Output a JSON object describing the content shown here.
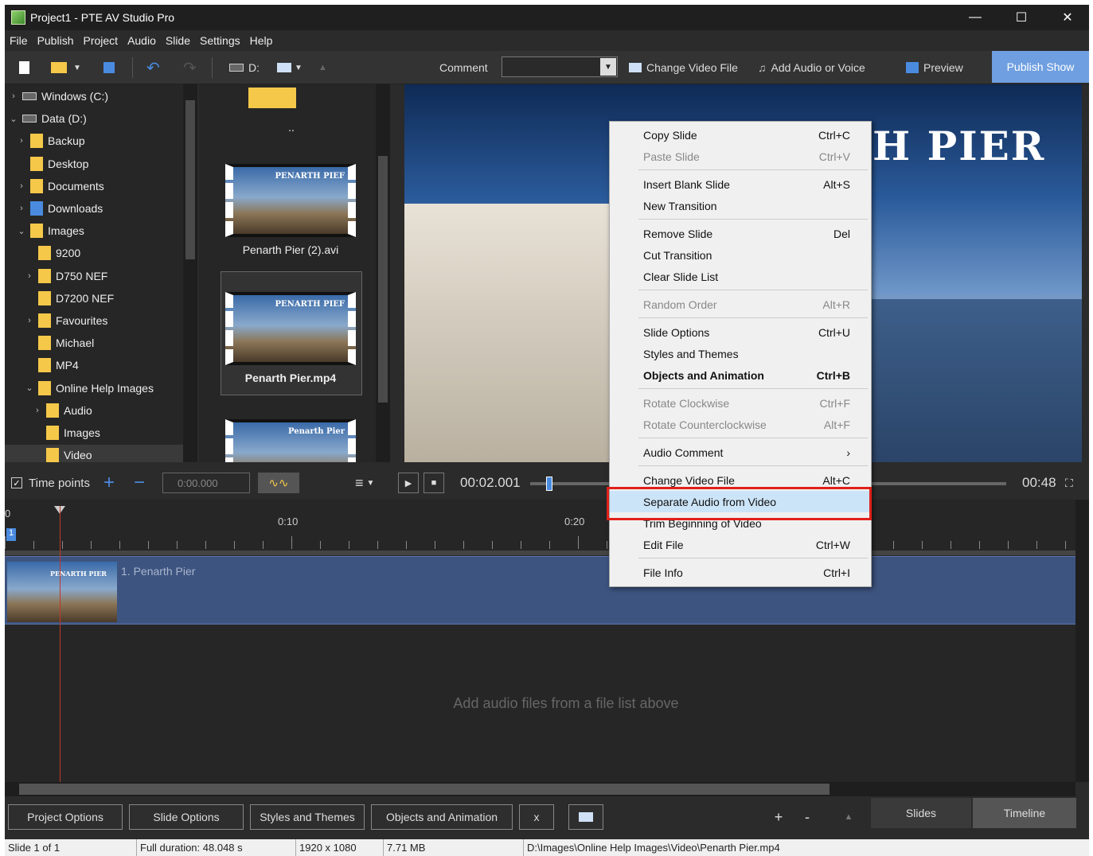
{
  "window": {
    "title": "Project1 - PTE AV Studio Pro"
  },
  "menu": [
    "File",
    "Publish",
    "Project",
    "Audio",
    "Slide",
    "Settings",
    "Help"
  ],
  "toolbar": {
    "drive_label": "D:",
    "comment_label": "Comment",
    "comment_value": "",
    "change_video": "Change Video File",
    "add_audio": "Add Audio or Voice",
    "preview": "Preview",
    "publish": "Publish Show"
  },
  "tree": [
    {
      "label": "Windows (C:)",
      "indent": 0,
      "chev": "›",
      "icon": "drive"
    },
    {
      "label": "Data (D:)",
      "indent": 0,
      "chev": "⌄",
      "icon": "drive"
    },
    {
      "label": "Backup",
      "indent": 1,
      "chev": "›",
      "icon": "folder"
    },
    {
      "label": "Desktop",
      "indent": 1,
      "chev": "",
      "icon": "folder"
    },
    {
      "label": "Documents",
      "indent": 1,
      "chev": "›",
      "icon": "folder"
    },
    {
      "label": "Downloads",
      "indent": 1,
      "chev": "›",
      "icon": "download"
    },
    {
      "label": "Images",
      "indent": 1,
      "chev": "⌄",
      "icon": "folder"
    },
    {
      "label": "9200",
      "indent": 2,
      "chev": "",
      "icon": "folder"
    },
    {
      "label": "D750 NEF",
      "indent": 2,
      "chev": "›",
      "icon": "folder"
    },
    {
      "label": "D7200 NEF",
      "indent": 2,
      "chev": "",
      "icon": "folder"
    },
    {
      "label": "Favourites",
      "indent": 2,
      "chev": "›",
      "icon": "folder"
    },
    {
      "label": "Michael",
      "indent": 2,
      "chev": "",
      "icon": "folder"
    },
    {
      "label": "MP4",
      "indent": 2,
      "chev": "",
      "icon": "folder"
    },
    {
      "label": "Online Help Images",
      "indent": 2,
      "chev": "⌄",
      "icon": "folder"
    },
    {
      "label": "Audio",
      "indent": 3,
      "chev": "›",
      "icon": "folder"
    },
    {
      "label": "Images",
      "indent": 3,
      "chev": "",
      "icon": "folder"
    },
    {
      "label": "Video",
      "indent": 3,
      "chev": "",
      "icon": "folder"
    }
  ],
  "files": {
    "up": "..",
    "items": [
      {
        "name": "Penarth Pier (2).avi",
        "thumb_text": "PENARTH PIEF"
      },
      {
        "name": "Penarth Pier.mp4",
        "thumb_text": "PENARTH PIEF"
      },
      {
        "name": "",
        "thumb_text": "Penarth Pier"
      }
    ]
  },
  "preview": {
    "title_text": "H PIER"
  },
  "controls": {
    "timepoints": "Time points",
    "time_value": "0:00.000",
    "current_time": "00:02.001",
    "total_time": "00:48"
  },
  "ruler": {
    "start": "0",
    "marks": [
      "0:10",
      "0:20"
    ],
    "marker": "1"
  },
  "track": {
    "slide_label": "1. Penarth Pier",
    "thumb_text": "PENARTH PIER"
  },
  "audio_hint": "Add audio files from a file list above",
  "bottom": {
    "buttons": [
      "Project Options",
      "Slide Options",
      "Styles and Themes",
      "Objects and Animation",
      "x"
    ],
    "plus": "+",
    "minus": "-",
    "tab_slides": "Slides",
    "tab_timeline": "Timeline"
  },
  "status": [
    "Slide 1 of 1",
    "Full duration: 48.048 s",
    "1920 x 1080",
    "7.71 MB",
    "D:\\Images\\Online Help Images\\Video\\Penarth Pier.mp4"
  ],
  "context_menu": [
    {
      "label": "Copy Slide",
      "shortcut": "Ctrl+C",
      "state": "normal"
    },
    {
      "label": "Paste Slide",
      "shortcut": "Ctrl+V",
      "state": "disabled"
    },
    {
      "sep": true
    },
    {
      "label": "Insert Blank Slide",
      "shortcut": "Alt+S",
      "state": "normal"
    },
    {
      "label": "New Transition",
      "shortcut": "",
      "state": "normal"
    },
    {
      "sep": true
    },
    {
      "label": "Remove Slide",
      "shortcut": "Del",
      "state": "normal"
    },
    {
      "label": "Cut Transition",
      "shortcut": "",
      "state": "normal"
    },
    {
      "label": "Clear Slide List",
      "shortcut": "",
      "state": "normal"
    },
    {
      "sep": true
    },
    {
      "label": "Random Order",
      "shortcut": "Alt+R",
      "state": "disabled"
    },
    {
      "sep": true
    },
    {
      "label": "Slide Options",
      "shortcut": "Ctrl+U",
      "state": "normal"
    },
    {
      "label": "Styles and Themes",
      "shortcut": "",
      "state": "normal"
    },
    {
      "label": "Objects and Animation",
      "shortcut": "Ctrl+B",
      "state": "bold"
    },
    {
      "sep": true
    },
    {
      "label": "Rotate Clockwise",
      "shortcut": "Ctrl+F",
      "state": "disabled"
    },
    {
      "label": "Rotate Counterclockwise",
      "shortcut": "Alt+F",
      "state": "disabled"
    },
    {
      "sep": true
    },
    {
      "label": "Audio Comment",
      "shortcut": "›",
      "state": "normal"
    },
    {
      "sep": true
    },
    {
      "label": "Change Video File",
      "shortcut": "Alt+C",
      "state": "normal"
    },
    {
      "label": "Separate Audio from Video",
      "shortcut": "",
      "state": "highlight"
    },
    {
      "label": "Trim Beginning of Video",
      "shortcut": "",
      "state": "normal"
    },
    {
      "label": "Edit File",
      "shortcut": "Ctrl+W",
      "state": "normal"
    },
    {
      "sep": true
    },
    {
      "label": "File Info",
      "shortcut": "Ctrl+I",
      "state": "normal"
    }
  ],
  "colors": {
    "accent": "#6f9fe0",
    "highlight": "#cce4f7",
    "callout": "#e0201a",
    "track": "#3d5480"
  }
}
